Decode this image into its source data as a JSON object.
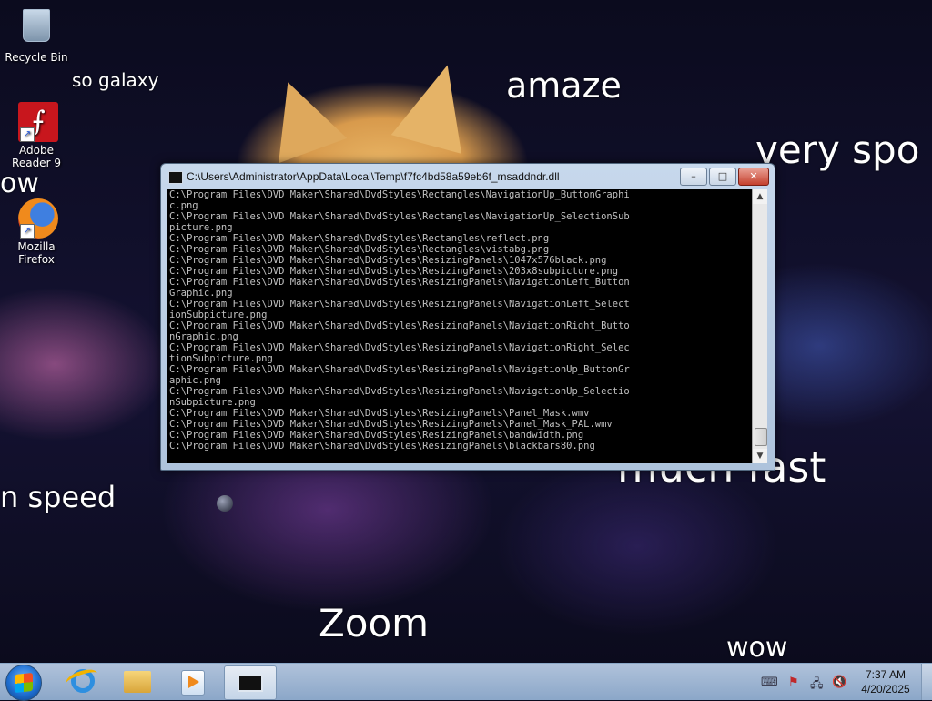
{
  "desktop": {
    "icons": [
      {
        "label": "Recycle Bin"
      },
      {
        "label": "Adobe Reader 9"
      },
      {
        "label": "Mozilla Firefox"
      }
    ],
    "meme_texts": {
      "so_galaxy": "so galaxy",
      "amaze": "amaze",
      "very_spo": "very spo",
      "ow": "ow",
      "much_fast": "much fast",
      "n_speed": "n speed",
      "zoom": "Zoom",
      "wow": "wow"
    }
  },
  "window": {
    "title": "C:\\Users\\Administrator\\AppData\\Local\\Temp\\f7fc4bd58a59eb6f_msaddndr.dll",
    "buttons": {
      "minimize": "–",
      "maximize": "□",
      "close": "✕"
    },
    "console_lines": [
      "C:\\Program Files\\DVD Maker\\Shared\\DvdStyles\\Rectangles\\NavigationUp_ButtonGraphi",
      "c.png",
      "C:\\Program Files\\DVD Maker\\Shared\\DvdStyles\\Rectangles\\NavigationUp_SelectionSub",
      "picture.png",
      "C:\\Program Files\\DVD Maker\\Shared\\DvdStyles\\Rectangles\\reflect.png",
      "C:\\Program Files\\DVD Maker\\Shared\\DvdStyles\\Rectangles\\vistabg.png",
      "C:\\Program Files\\DVD Maker\\Shared\\DvdStyles\\ResizingPanels\\1047x576black.png",
      "C:\\Program Files\\DVD Maker\\Shared\\DvdStyles\\ResizingPanels\\203x8subpicture.png",
      "C:\\Program Files\\DVD Maker\\Shared\\DvdStyles\\ResizingPanels\\NavigationLeft_Button",
      "Graphic.png",
      "C:\\Program Files\\DVD Maker\\Shared\\DvdStyles\\ResizingPanels\\NavigationLeft_Select",
      "ionSubpicture.png",
      "C:\\Program Files\\DVD Maker\\Shared\\DvdStyles\\ResizingPanels\\NavigationRight_Butto",
      "nGraphic.png",
      "C:\\Program Files\\DVD Maker\\Shared\\DvdStyles\\ResizingPanels\\NavigationRight_Selec",
      "tionSubpicture.png",
      "C:\\Program Files\\DVD Maker\\Shared\\DvdStyles\\ResizingPanels\\NavigationUp_ButtonGr",
      "aphic.png",
      "C:\\Program Files\\DVD Maker\\Shared\\DvdStyles\\ResizingPanels\\NavigationUp_Selectio",
      "nSubpicture.png",
      "C:\\Program Files\\DVD Maker\\Shared\\DvdStyles\\ResizingPanels\\Panel_Mask.wmv",
      "C:\\Program Files\\DVD Maker\\Shared\\DvdStyles\\ResizingPanels\\Panel_Mask_PAL.wmv",
      "C:\\Program Files\\DVD Maker\\Shared\\DvdStyles\\ResizingPanels\\bandwidth.png",
      "C:\\Program Files\\DVD Maker\\Shared\\DvdStyles\\ResizingPanels\\blackbars80.png"
    ],
    "scroll_arrows": {
      "up": "▲",
      "down": "▼"
    }
  },
  "taskbar": {
    "clock": {
      "time": "7:37 AM",
      "date": "4/20/2025"
    },
    "tray_icons": [
      "keyboard-icon",
      "action-center-flag-icon",
      "network-icon",
      "volume-muted-icon"
    ]
  }
}
